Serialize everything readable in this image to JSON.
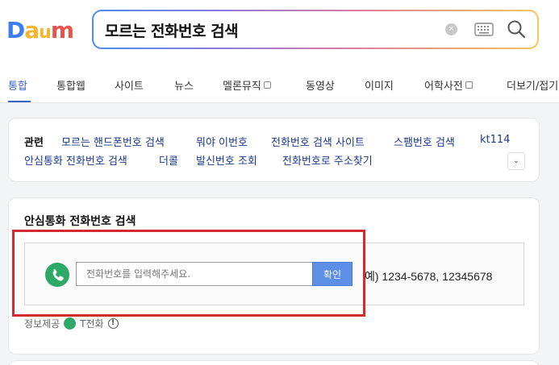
{
  "logo": {
    "text": "Daum"
  },
  "search": {
    "query": "모르는 전화번호 검색",
    "clear_icon": "close-circle-icon",
    "keyboard_icon": "keyboard-icon",
    "search_icon": "search-icon"
  },
  "tabs": [
    {
      "label": "통합",
      "active": true
    },
    {
      "label": "통합웹"
    },
    {
      "label": "사이트"
    },
    {
      "label": "뉴스"
    },
    {
      "label": "멜론뮤직",
      "external": true
    },
    {
      "label": "동영상"
    },
    {
      "label": "이미지"
    },
    {
      "label": "어학사전",
      "external": true
    },
    {
      "label": "더보기/접기"
    }
  ],
  "related": {
    "title": "관련",
    "links": [
      "모르는 핸드폰번호 검색",
      "뭐야 이번호",
      "전화번호 검색 사이트",
      "스팸번호 검색",
      "kt114",
      "안심통화 전화번호 검색",
      "더콜",
      "발신번호 조회",
      "전화번호로 주소찾기"
    ]
  },
  "safe_call": {
    "title": "안심통화 전화번호 검색",
    "input_placeholder": "전화번호를 입력해주세요.",
    "confirm_label": "확인",
    "example_text": "예) 1234-5678, 12345678",
    "provider_label": "정보제공",
    "provider_name": "T전화"
  },
  "colors": {
    "accent": "#3465c5",
    "confirm": "#5d8fe6",
    "phone_green": "#2ea866",
    "highlight_red": "#d12b30"
  }
}
